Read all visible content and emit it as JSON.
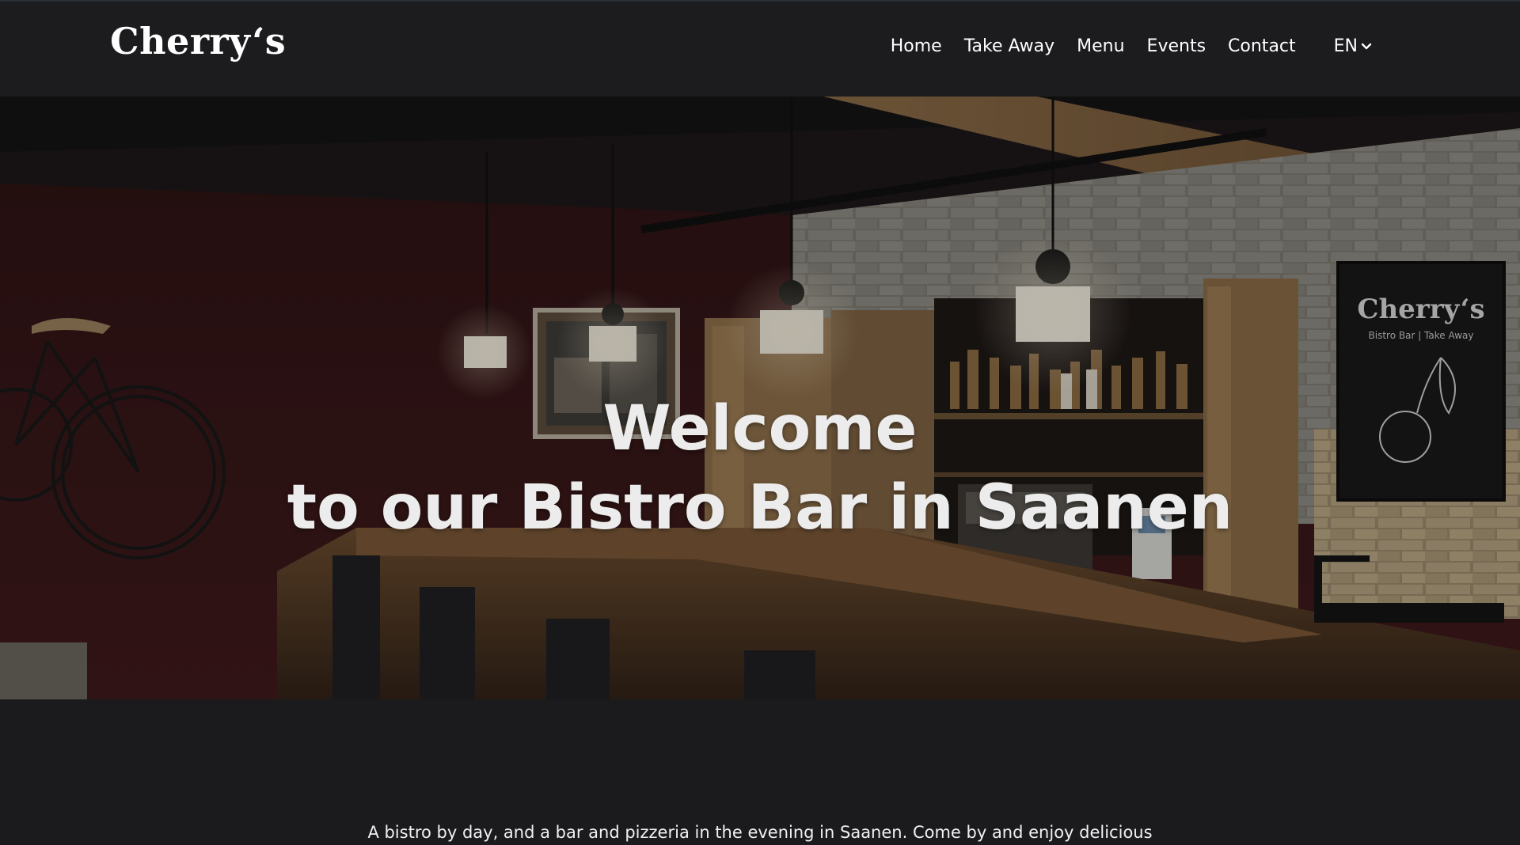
{
  "header": {
    "logo": "Cherry‘s",
    "nav": [
      {
        "label": "Home"
      },
      {
        "label": "Take Away"
      },
      {
        "label": "Menu"
      },
      {
        "label": "Events"
      },
      {
        "label": "Contact"
      }
    ],
    "language": "EN"
  },
  "hero": {
    "title_line1": "Welcome",
    "title_line2": "to our Bistro Bar in Saanen",
    "chalkboard_logo": "Cherry‘s",
    "chalkboard_subtitle": "Bistro Bar | Take Away"
  },
  "intro": {
    "text": "A bistro by day, and a bar and pizzeria in the evening in Saanen. Come by and enjoy delicious drinks and food in a cozy, family-friendly atmosphere. We look forward to your visit!"
  },
  "colors": {
    "background": "#1c1c1e",
    "text": "#ffffff",
    "wall": "#3a1414",
    "wood": "#7a5632"
  }
}
